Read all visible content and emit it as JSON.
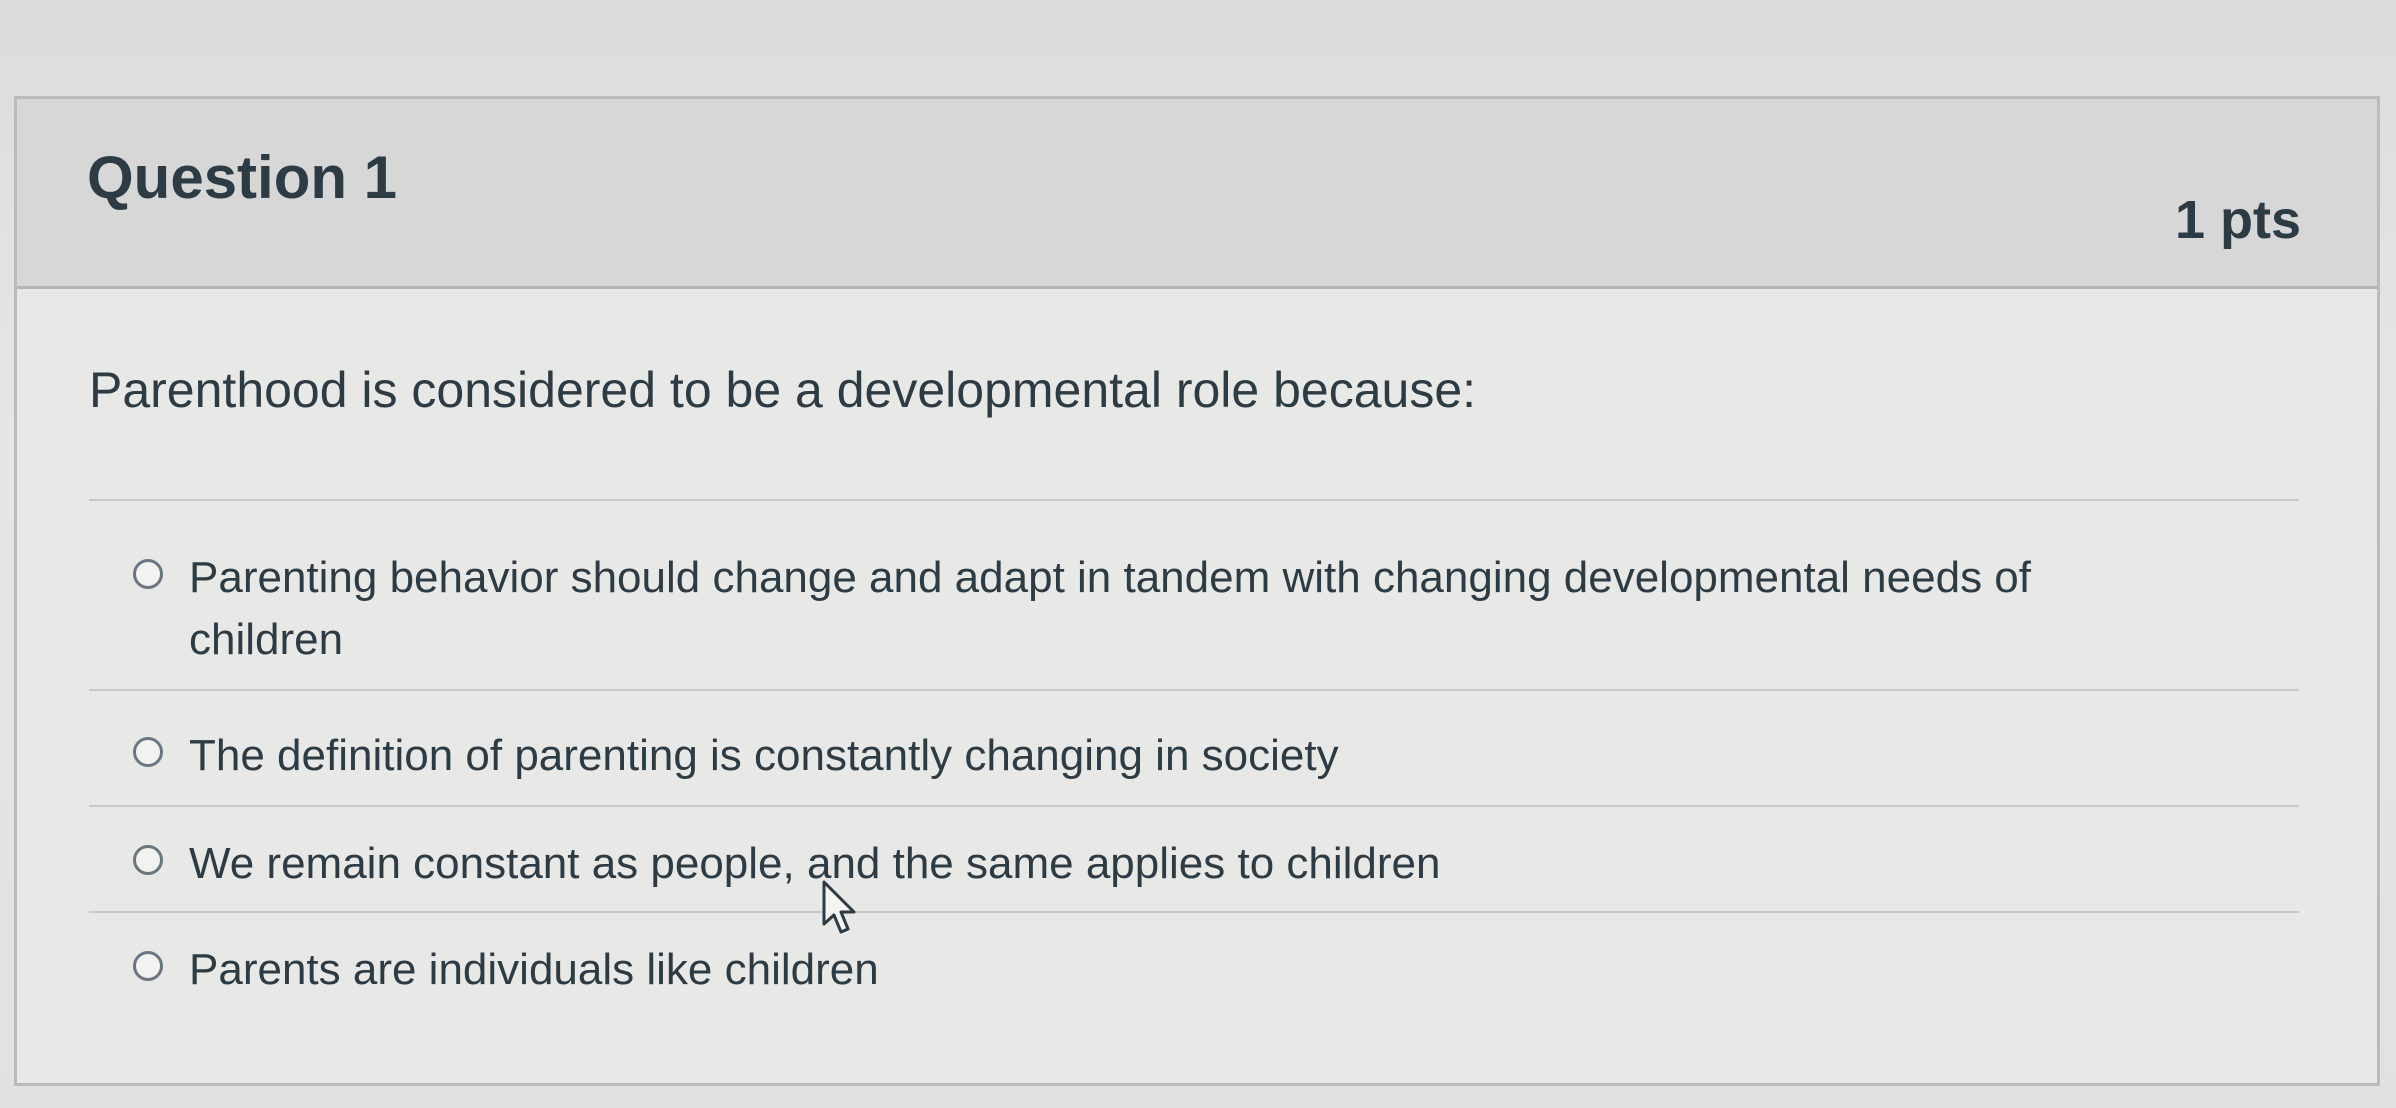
{
  "question": {
    "title": "Question 1",
    "points": "1 pts",
    "text": "Parenthood is considered to be a developmental role because:",
    "answers": [
      {
        "label": "Parenting behavior should change and adapt in tandem with changing developmental needs of children"
      },
      {
        "label": "The definition of parenting is constantly changing in society"
      },
      {
        "label": "We remain constant as people, and the same applies to children"
      },
      {
        "label": "Parents are individuals like children"
      }
    ]
  },
  "colors": {
    "header_bg": "#d6d7d6",
    "card_bg": "#e8e8e6",
    "text": "#2d3b45",
    "border": "#b9bcbe"
  },
  "icons": {
    "radio": "radio-unchecked-icon",
    "cursor": "mouse-pointer-icon"
  }
}
